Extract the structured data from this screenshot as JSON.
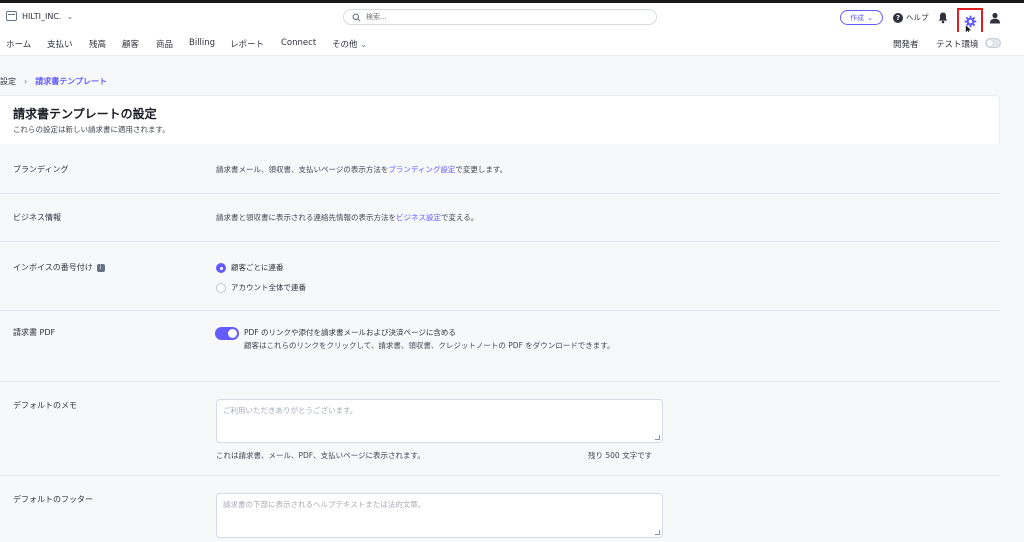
{
  "header": {
    "account_name": "HILTI_INC.",
    "search_placeholder": "検索...",
    "create_label": "作成",
    "help_label": "ヘルプ"
  },
  "nav": {
    "items": [
      "ホーム",
      "支払い",
      "残高",
      "顧客",
      "商品",
      "Billing",
      "レポート",
      "Connect",
      "その他"
    ],
    "developers": "開発者",
    "test_mode": "テスト環境"
  },
  "breadcrumb": {
    "parent": "設定",
    "current": "請求書テンプレート"
  },
  "page": {
    "title": "請求書テンプレートの設定",
    "subtitle": "これらの設定は新しい請求書に適用されます。"
  },
  "branding": {
    "label": "ブランディング",
    "text_before": "請求書メール、領収書、支払いページの表示方法を",
    "link": "ブランディング設定",
    "text_after": "で変更します。"
  },
  "business": {
    "label": "ビジネス情報",
    "text_before": "請求書と領収書に表示される連絡先情報の表示方法を",
    "link": "ビジネス設定",
    "text_after": "で変える。"
  },
  "numbering": {
    "label": "インボイスの番号付け",
    "option_1": "顧客ごとに連番",
    "option_2": "アカウント全体で連番",
    "selected": "顧客ごとに連番"
  },
  "pdf": {
    "label": "請求書 PDF",
    "toggle_title": "PDF のリンクや添付を請求書メールおよび決済ページに含める",
    "description": "顧客はこれらのリンクをクリックして、請求書、領収書、クレジットノートの PDF をダウンロードできます。",
    "enabled": true
  },
  "memo": {
    "label": "デフォルトのメモ",
    "placeholder": "ご利用いただきありがとうございます。",
    "note": "これは請求書、メール、PDF、支払いページに表示されます。",
    "remaining": "残り 500 文字です"
  },
  "footer_field": {
    "label": "デフォルトのフッター",
    "placeholder": "請求書の下部に表示されるヘルプテキストまたは法的文章。"
  },
  "colors": {
    "accent": "#635bff",
    "highlight_box": "#e01e1e"
  }
}
